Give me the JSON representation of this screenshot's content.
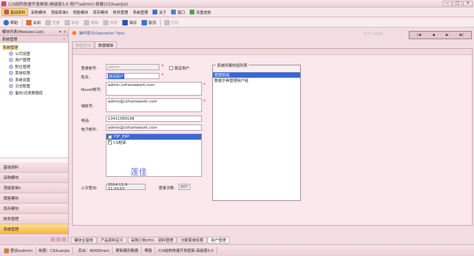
{
  "window": {
    "title": "C/S结构快速开发框架-高级版3.0 用户(admin) 帐套(CSXuanJia)",
    "buttons": [
      "—",
      "□",
      "×"
    ]
  },
  "menubar": {
    "items": [
      {
        "label": "基础资料",
        "icon_color": "#c85070",
        "active": true
      },
      {
        "label": "采购模块",
        "active": false
      },
      {
        "label": "顶级菜单II",
        "active": false
      },
      {
        "label": "销售模块",
        "active": false
      },
      {
        "label": "库存模块",
        "active": false
      },
      {
        "label": "财务管理",
        "active": false
      },
      {
        "label": "系统管理",
        "active": false
      },
      {
        "label": "关于",
        "icon_color": "#4070c0",
        "active": false
      },
      {
        "label": "窗口",
        "icon_color": "#5080c8",
        "active": false
      },
      {
        "label": "设置皮肤",
        "icon_color": "#50a050",
        "active": false
      }
    ]
  },
  "toolbar": {
    "help": "帮助",
    "close": "关闭",
    "view": "查看",
    "add": "新增",
    "delete": "删除",
    "edit": "修改",
    "save": "保存",
    "cancel": "取消",
    "print": "打印"
  },
  "left": {
    "header": "模块列表(Modules List)",
    "section": "系统管理",
    "collapse": "«",
    "tree_root": "系统管理",
    "tree_items": [
      "公司设置",
      "用户管理",
      "职位管理",
      "菜单权限",
      "系统设置",
      "日志配置",
      "备份/还原数据库"
    ],
    "nav": [
      "基础资料",
      "采购模块",
      "顶级菜单II",
      "销售模块",
      "库存模块",
      "财务管理",
      "系统管理"
    ]
  },
  "main": {
    "op_hint": "操作提示(Operation Tips)",
    "about": "关于C/S框架",
    "tabs": [
      "数据查询",
      "数据编辑"
    ],
    "form": {
      "account_label": "登录帐号:",
      "account_value": "admin",
      "lock_label": "锁定用户",
      "name_label": "姓名:",
      "name_value": "测试用户",
      "novell_label": "Novell帐号:",
      "novell_value": "admin.csframework.com",
      "domain_label": "域帐号:",
      "domain_value": "admin@csframework.com",
      "phone_label": "电话:",
      "phone_value": "13411589198",
      "email_label": "电子邮件:",
      "email_value": "admin@csframework.com",
      "accounts": [
        {
          "label": "YSF_ERP",
          "checked": true,
          "selected": true
        },
        {
          "label": "CS框架",
          "checked": true,
          "selected": false
        }
      ],
      "watermark": "莲佳",
      "last_logout_label": "上次登出:",
      "last_logout_value": "2014-11-9 21:33:07",
      "login_count_label": "登录次数:",
      "login_count_value": "607",
      "group_title": "系统所属的组列表",
      "groups": [
        "管理员组",
        "数据字典管理用户组"
      ]
    },
    "bottom_tabs": [
      "模块主窗体",
      "产品资料定义",
      "采购订单(PO) - 资料管理",
      "分配菜单权限",
      "用户管理"
    ]
  },
  "statusbar": {
    "user": "登出(admin)",
    "account": "帐套：CSXuanJia",
    "backend": "后台：ADODirect",
    "cache": "更新缓存数据",
    "help": "帮助",
    "product": "C/S结构快速开发框架-高级版3.0"
  }
}
